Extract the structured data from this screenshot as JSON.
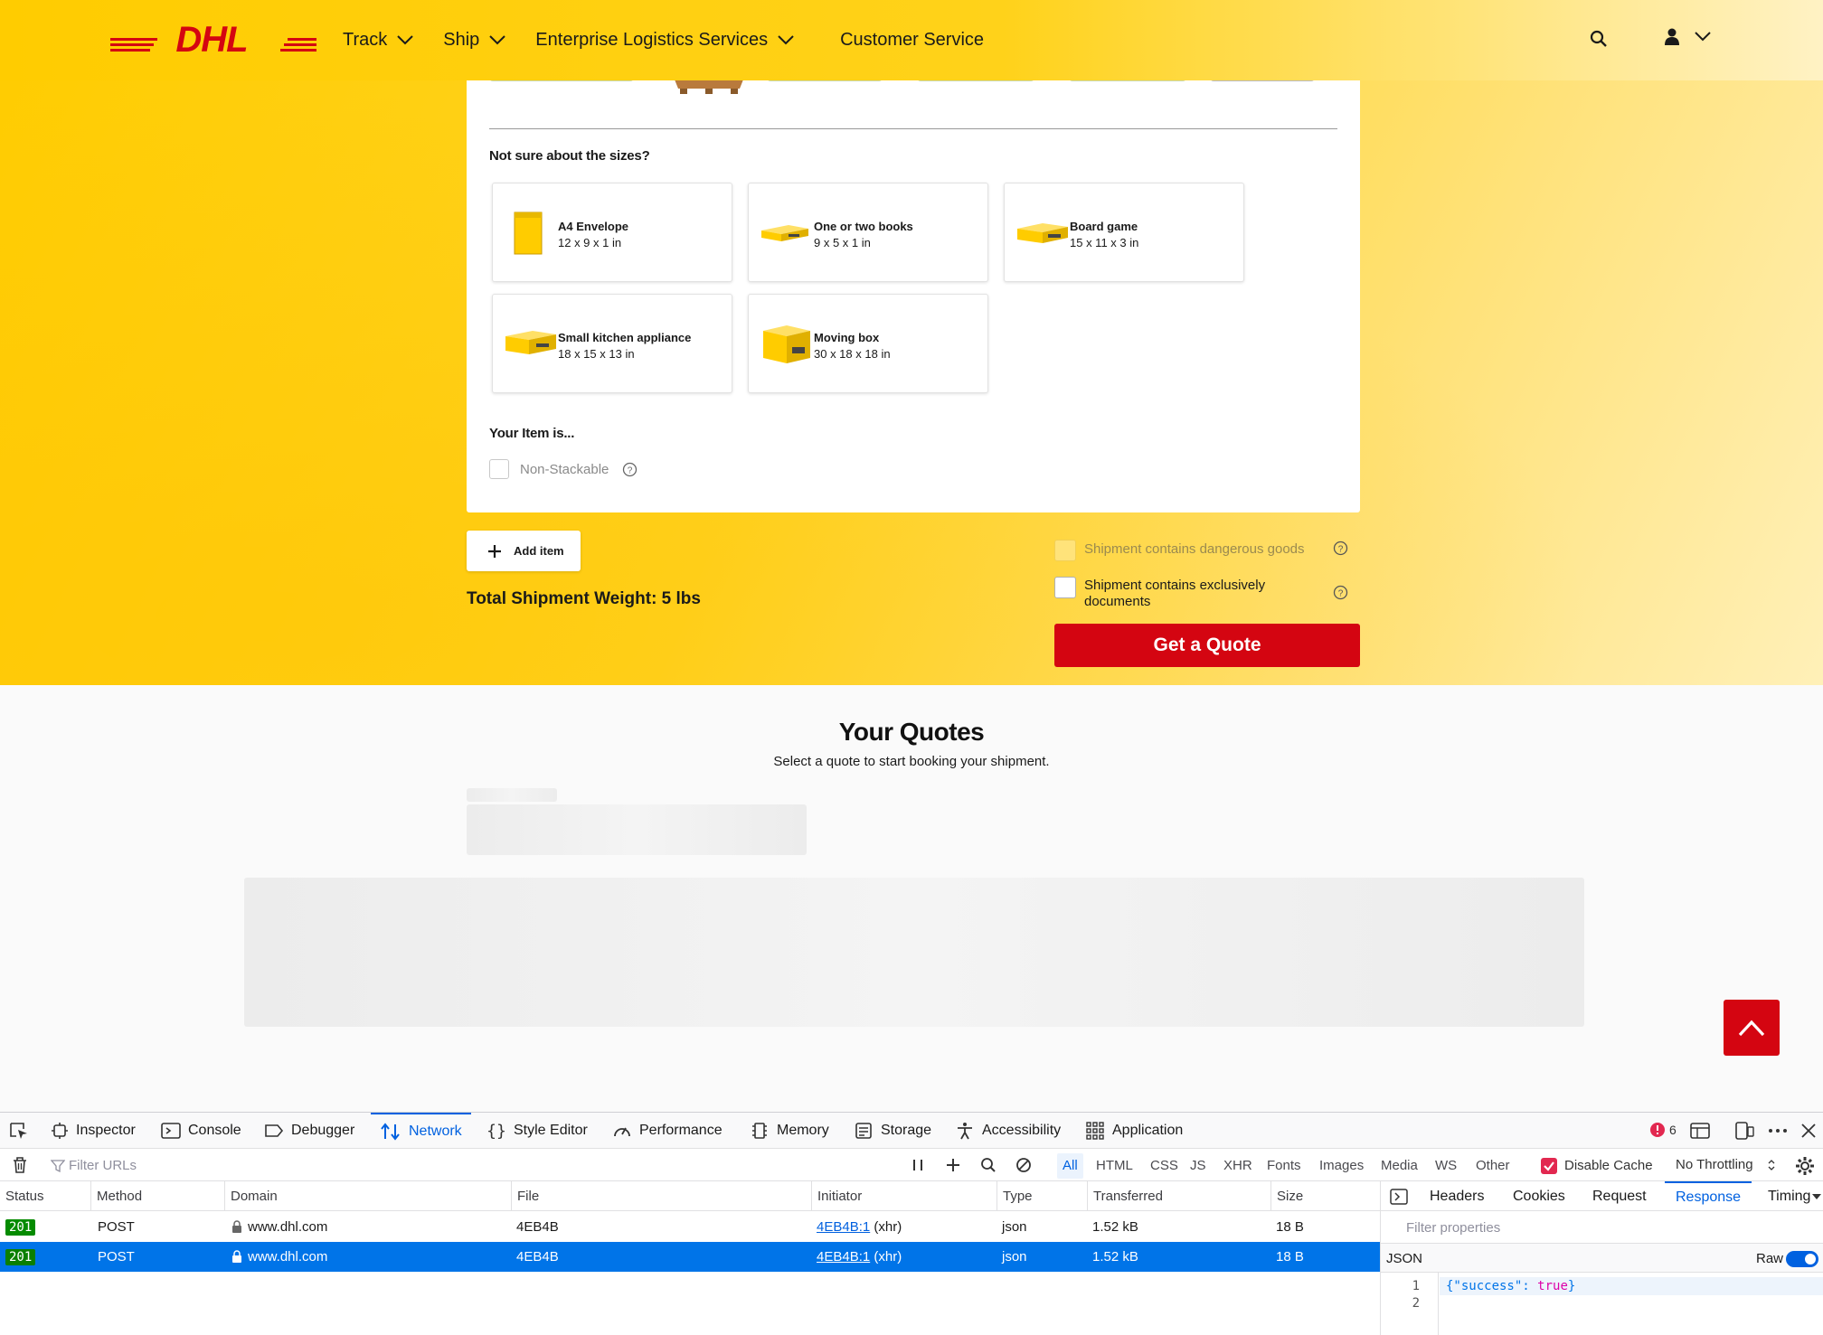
{
  "header": {
    "logo_text": "DHL",
    "nav": [
      "Track",
      "Ship",
      "Enterprise Logistics Services",
      "Customer Service"
    ],
    "icons": [
      "search-icon",
      "user-icon",
      "chevron-down-icon"
    ]
  },
  "form": {
    "sizes_heading": "Not sure about the sizes?",
    "sizes": [
      {
        "name": "A4 Envelope",
        "dims": "12 x 9 x 1 in"
      },
      {
        "name": "One or two books",
        "dims": "9 x 5 x 1 in"
      },
      {
        "name": "Board game",
        "dims": "15 x 11 x 3 in"
      },
      {
        "name": "Small kitchen appliance",
        "dims": "18 x 15 x 13 in"
      },
      {
        "name": "Moving box",
        "dims": "30 x 18 x 18 in"
      }
    ],
    "item_heading": "Your Item is...",
    "non_stackable": "Non-Stackable",
    "add_item": "Add item",
    "total_weight": "Total Shipment Weight: 5 lbs",
    "dangerous_goods": "Shipment contains dangerous goods",
    "documents_only": "Shipment contains exclusively documents",
    "get_quote": "Get a Quote"
  },
  "quotes": {
    "title": "Your Quotes",
    "subtitle": "Select a quote to start booking your shipment."
  },
  "devtools": {
    "tabs": [
      "Inspector",
      "Console",
      "Debugger",
      "Network",
      "Style Editor",
      "Performance",
      "Memory",
      "Storage",
      "Accessibility",
      "Application"
    ],
    "active_tab": "Network",
    "error_count": "6",
    "filter_placeholder": "Filter URLs",
    "type_filters": [
      "All",
      "HTML",
      "CSS",
      "JS",
      "XHR",
      "Fonts",
      "Images",
      "Media",
      "WS",
      "Other"
    ],
    "disable_cache": "Disable Cache",
    "throttling": "No Throttling",
    "columns": [
      "Status",
      "Method",
      "Domain",
      "File",
      "Initiator",
      "Type",
      "Transferred",
      "Size"
    ],
    "rows": [
      {
        "status": "201",
        "method": "POST",
        "domain": "www.dhl.com",
        "file": "4EB4B",
        "initiator": "4EB4B:1",
        "initiator_suffix": "(xhr)",
        "type": "json",
        "transferred": "1.52 kB",
        "size": "18 B"
      },
      {
        "status": "201",
        "method": "POST",
        "domain": "www.dhl.com",
        "file": "4EB4B",
        "initiator": "4EB4B:1",
        "initiator_suffix": "(xhr)",
        "type": "json",
        "transferred": "1.52 kB",
        "size": "18 B"
      }
    ],
    "side_tabs": [
      "Headers",
      "Cookies",
      "Request",
      "Response",
      "Timings"
    ],
    "side_active": "Response",
    "props_placeholder": "Filter properties",
    "json_label": "JSON",
    "raw_label": "Raw",
    "code_lines": [
      "1",
      "2"
    ],
    "code_key": "{\"success\": ",
    "code_val": "true",
    "code_end": "}"
  },
  "colors": {
    "brand_yellow": "#ffcc00",
    "brand_red": "#d40511",
    "devtools_blue": "#0061e0"
  }
}
